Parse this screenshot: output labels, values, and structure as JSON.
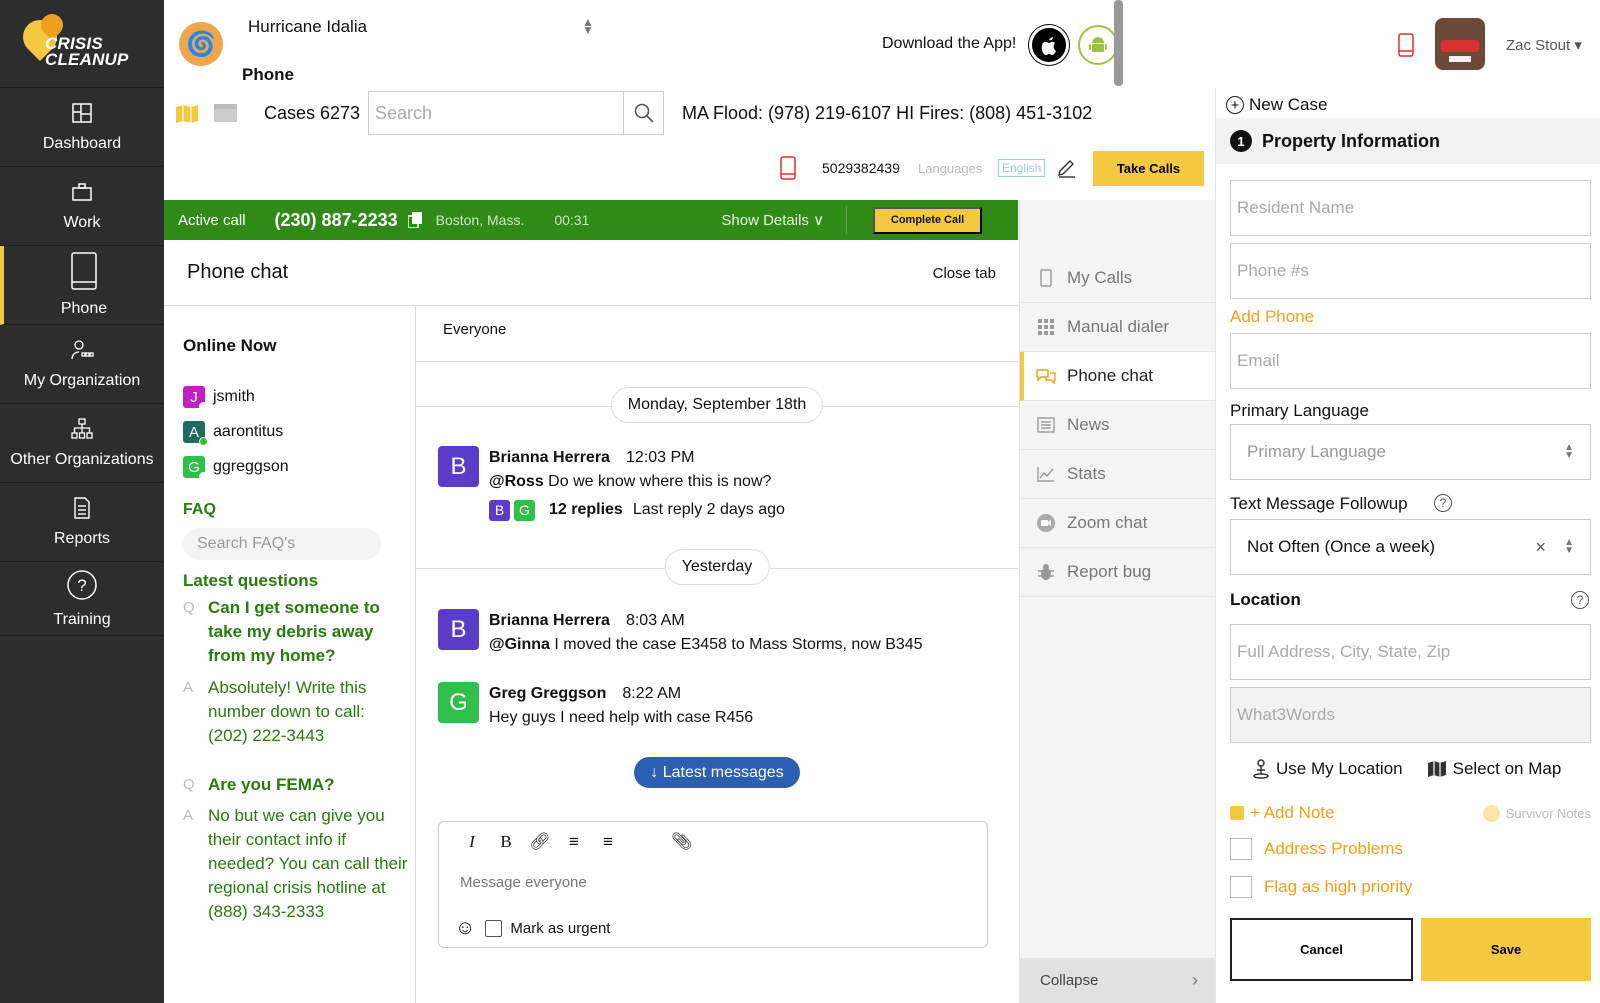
{
  "app": {
    "logo_line1": "CRISIS",
    "logo_line2": "CLEANUP"
  },
  "sidebar": {
    "items": [
      {
        "label": "Dashboard",
        "icon": "dashboard-icon"
      },
      {
        "label": "Work",
        "icon": "briefcase-icon"
      },
      {
        "label": "Phone",
        "icon": "phone-icon",
        "active": true
      },
      {
        "label": "My Organization",
        "icon": "organization-icon"
      },
      {
        "label": "Other Organizations",
        "icon": "org-chart-icon"
      },
      {
        "label": "Reports",
        "icon": "report-icon"
      },
      {
        "label": "Training",
        "icon": "help-circle-icon"
      }
    ]
  },
  "header": {
    "incident": "Hurricane Idalia",
    "page_title": "Phone",
    "download_text": "Download the App!",
    "user_name": "Zac Stout ▾",
    "cases_label": "Cases 6273",
    "search_placeholder": "Search",
    "hotlines": "MA Flood: (978) 219-6107  HI Fires: (808) 451-3102",
    "phone_number": "5029382439",
    "languages_label": "Languages",
    "language_value": "English",
    "take_calls_label": "Take Calls"
  },
  "active_call": {
    "label": "Active call",
    "number": "(230) 887-2233",
    "location": "Boston, Mass.",
    "timer": "00:31",
    "show_details": "Show Details ∨",
    "complete_label": "Complete Call"
  },
  "chat": {
    "title": "Phone chat",
    "close_tab": "Close tab",
    "online_title": "Online Now",
    "online_users": [
      {
        "initial": "J",
        "name": "jsmith",
        "color": "#c21fc2",
        "status": "#ffffff"
      },
      {
        "initial": "A",
        "name": "aarontitus",
        "color": "#1f6b5e",
        "status": "#2fbf2f"
      },
      {
        "initial": "G",
        "name": "ggreggson",
        "color": "#2fbf4a",
        "status": "#ffffff"
      }
    ],
    "faq_title": "FAQ",
    "faq_search_placeholder": "Search FAQ's",
    "latest_questions": "Latest questions",
    "faqs": [
      {
        "q": "Can I get someone to take my debris away from my home?",
        "a": "Absolutely! Write this number down to call: (202) 222-3443"
      },
      {
        "q": "Are you FEMA?",
        "a": "No but we can give you their contact info if needed? You can call their regional crisis hotline at (888) 343-2333"
      }
    ],
    "q_mark": "Q",
    "a_mark": "A",
    "channel": "Everyone",
    "date1": "Monday, September 18th",
    "date2": "Yesterday",
    "messages": [
      {
        "initial": "B",
        "color": "#5a3cc8",
        "name": "Brianna Herrera",
        "time": "12:03 PM",
        "mention": "@Ross",
        "text": " Do we know where this is now?"
      },
      {
        "initial": "B",
        "color": "#5a3cc8",
        "name": "Brianna Herrera",
        "time": "8:03 AM",
        "mention": "@Ginna",
        "text": " I moved the case E3458 to Mass Storms, now B345"
      },
      {
        "initial": "G",
        "color": "#2fbf4a",
        "name": "Greg Greggson",
        "time": "8:22 AM",
        "mention": "",
        "text": "Hey guys I need help with case R456"
      }
    ],
    "replies": {
      "avatars": [
        {
          "initial": "B",
          "color": "#5a3cc8"
        },
        {
          "initial": "G",
          "color": "#2fbf4a"
        }
      ],
      "count": "12 replies",
      "last": "Last reply 2 days ago"
    },
    "latest_messages": "↓ Latest messages",
    "composer_placeholder": "Message everyone",
    "mark_urgent": "Mark as urgent"
  },
  "side_menu": {
    "items": [
      {
        "label": "My Calls",
        "icon": "mobile-icon"
      },
      {
        "label": "Manual dialer",
        "icon": "dialpad-icon"
      },
      {
        "label": "Phone chat",
        "icon": "chat-icon",
        "active": true
      },
      {
        "label": "News",
        "icon": "news-icon"
      },
      {
        "label": "Stats",
        "icon": "stats-icon"
      },
      {
        "label": "Zoom chat",
        "icon": "zoom-icon"
      },
      {
        "label": "Report bug",
        "icon": "bug-icon"
      }
    ],
    "collapse": "Collapse"
  },
  "case_form": {
    "new_case": "New Case",
    "section_number": "1",
    "section_title": "Property Information",
    "resident_name_placeholder": "Resident Name",
    "phone_placeholder": "Phone #s",
    "add_phone": "Add Phone",
    "email_placeholder": "Email",
    "primary_language_label": "Primary Language",
    "primary_language_placeholder": "Primary Language",
    "text_followup_label": "Text Message Followup",
    "text_followup_value": "Not Often (Once a week)",
    "location_label": "Location",
    "address_placeholder": "Full Address, City, State, Zip",
    "what3words_placeholder": "What3Words",
    "use_my_location": "Use My Location",
    "select_on_map": "Select on Map",
    "add_note": "+ Add Note",
    "survivor_notes": "Survivor Notes",
    "address_problems": "Address Problems",
    "flag_priority": "Flag as high priority",
    "cancel": "Cancel",
    "save": "Save"
  }
}
